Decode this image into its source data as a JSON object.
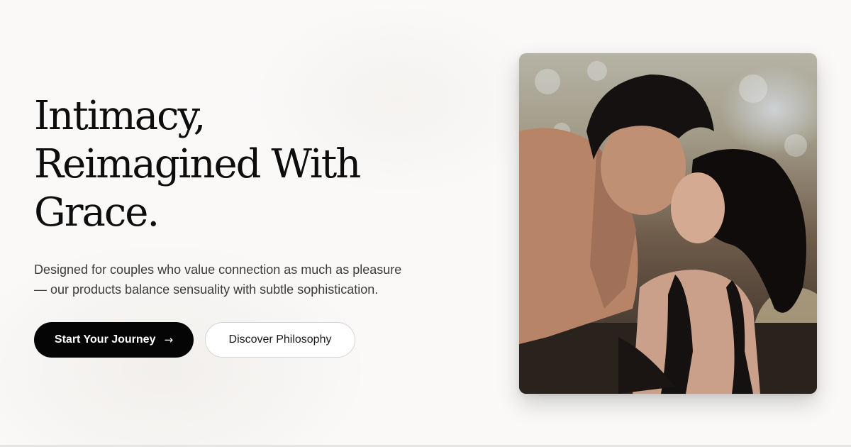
{
  "hero": {
    "title_lines": [
      "Intimacy,",
      "Reimagined With",
      "Grace."
    ],
    "subtitle_lines": [
      "Designed for couples who value connection as much as pleasure",
      "— our products balance sensuality with subtle sophistication."
    ]
  },
  "buttons": {
    "primary_label": "Start Your Journey",
    "primary_icon": "arrow-right-icon",
    "secondary_label": "Discover Philosophy"
  },
  "colors": {
    "background": "#faf9f8",
    "text": "#0d0d0d",
    "primary_button": "#050505",
    "secondary_border": "#d7d5d3"
  }
}
